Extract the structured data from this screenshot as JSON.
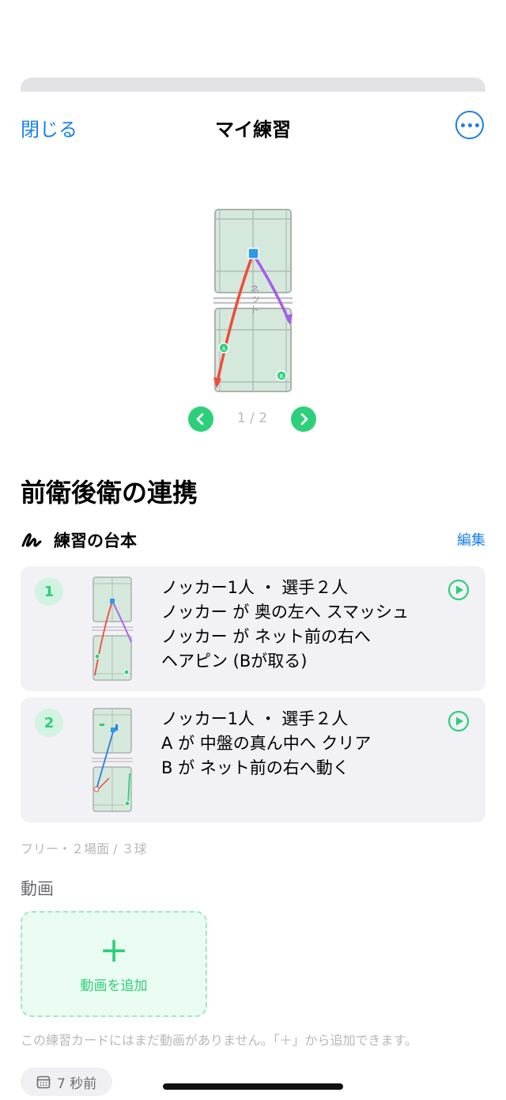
{
  "nav": {
    "close_label": "閉じる",
    "title": "マイ練習",
    "more_icon": "ellipsis-circle-icon"
  },
  "preview": {
    "net_label": "ネット",
    "player_a": "A",
    "player_b": "B",
    "page_indicator": "1 / 2"
  },
  "drill": {
    "title": "前衛後衛の連携"
  },
  "script": {
    "label": "練習の台本",
    "edit_label": "編集",
    "icon": "signature-icon"
  },
  "steps": [
    {
      "number": "1",
      "lines": [
        "ノッカー1人 ・ 選手２人",
        "ノッカー が 奥の左へ スマッシュ",
        "ノッカー が ネット前の右へ",
        "ヘアピン (Bが取る)"
      ]
    },
    {
      "number": "2",
      "lines": [
        "ノッカー1人 ・ 選手２人",
        "A が 中盤の真ん中へ クリア",
        "B が ネット前の右へ動く"
      ]
    }
  ],
  "summary": "フリー・２場面 / ３球",
  "video": {
    "heading": "動画",
    "add_plus": "+",
    "add_label": "動画を追加",
    "note": "この練習カードにはまだ動画がありません。「＋」から追加できます。"
  },
  "timestamp": "7 秒前",
  "colors": {
    "accent_blue": "#1a7fe8",
    "accent_green": "#2ecf7a",
    "court_fill": "#d5e8dc",
    "shot_red": "#f04a3c",
    "shot_purple": "#a55ee8",
    "shot_blue": "#2a7fe0"
  }
}
